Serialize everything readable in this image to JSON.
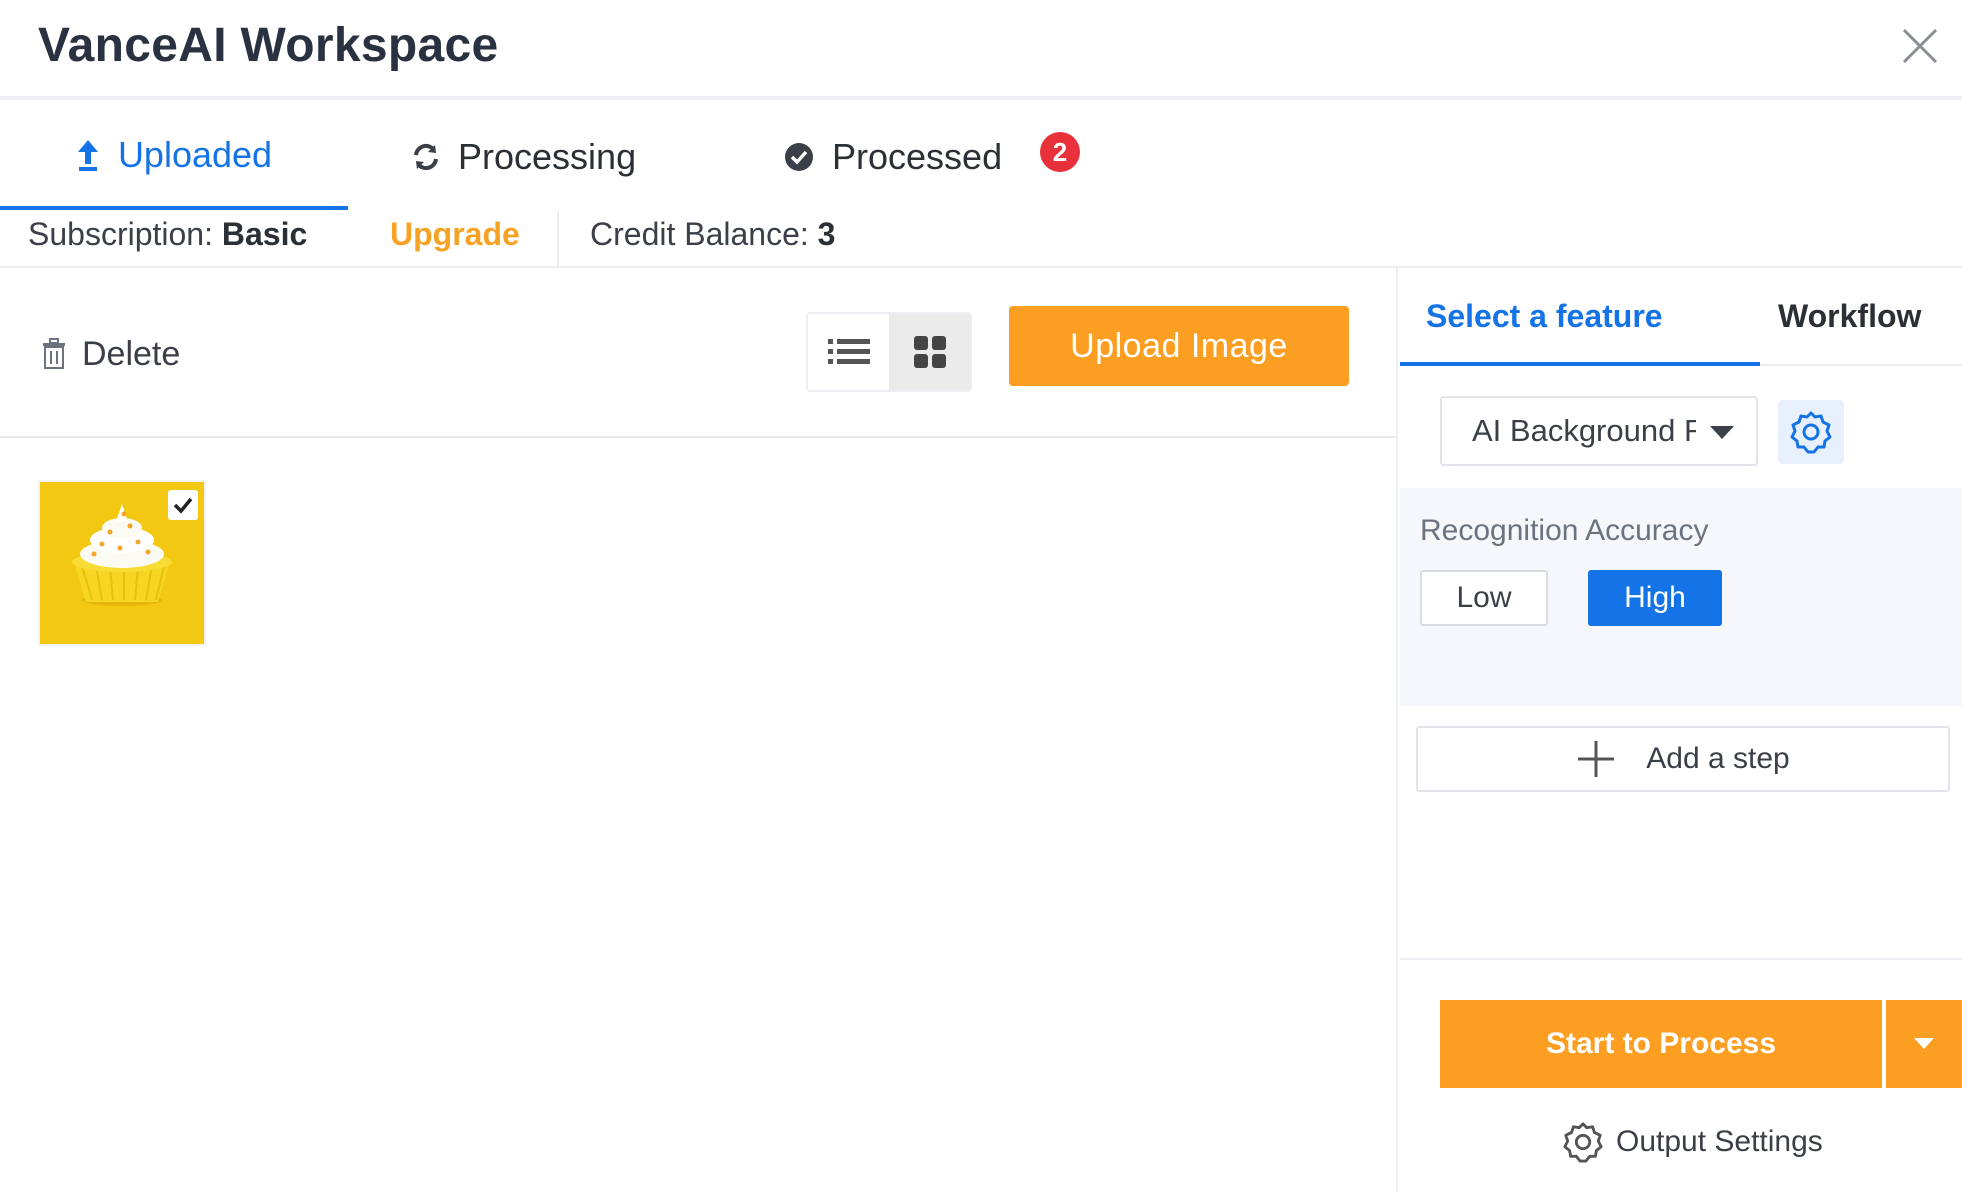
{
  "window": {
    "title": "VanceAI Workspace",
    "close_icon": "close-icon"
  },
  "tabs": [
    {
      "label": "Uploaded",
      "icon": "arrow-up-icon",
      "active": true
    },
    {
      "label": "Processing",
      "icon": "refresh-icon",
      "active": false
    },
    {
      "label": "Processed",
      "icon": "check-circle-icon",
      "active": false,
      "badge": "2"
    }
  ],
  "subscription": {
    "label": "Subscription:",
    "plan": "Basic",
    "upgrade_label": "Upgrade",
    "credit_label": "Credit Balance:",
    "credit_value": "3"
  },
  "toolbar": {
    "delete_label": "Delete",
    "view_modes": [
      "list",
      "grid"
    ],
    "active_view": "grid",
    "upload_label": "Upload Image"
  },
  "uploaded_images": [
    {
      "description": "yellow cupcake",
      "selected": true
    }
  ],
  "right_panel": {
    "tabs": [
      {
        "label": "Select a feature",
        "active": true
      },
      {
        "label": "Workflow",
        "active": false
      }
    ],
    "feature_select_value": "AI Background R",
    "recognition": {
      "label": "Recognition Accuracy",
      "options": [
        "Low",
        "High"
      ],
      "selected": "High"
    },
    "add_step_label": "Add a step",
    "start_label": "Start to Process",
    "output_settings_label": "Output Settings"
  },
  "colors": {
    "accent_blue": "#1473e6",
    "accent_orange": "#fb9e22",
    "badge_red": "#e8313a",
    "upgrade_orange": "#f7a224"
  }
}
